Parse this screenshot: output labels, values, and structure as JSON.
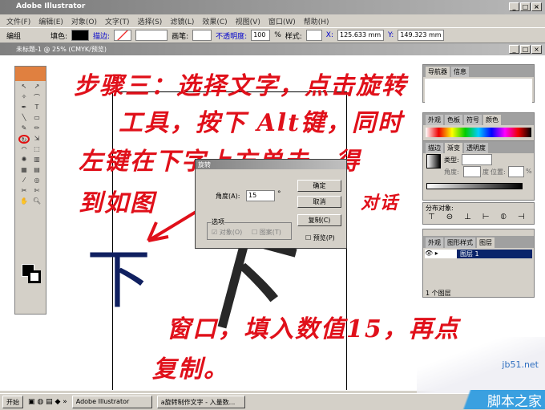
{
  "app": {
    "title": "Adobe Illustrator",
    "doc_title": "未标题-1 @ 25% (CMYK/预览)"
  },
  "menu": [
    "文件(F)",
    "编辑(E)",
    "对象(O)",
    "文字(T)",
    "选择(S)",
    "滤镜(L)",
    "效果(C)",
    "视图(V)",
    "窗口(W)",
    "帮助(H)"
  ],
  "toolbar": {
    "group": "编组",
    "fill": "填色:",
    "stroke": "描边:",
    "brush": "画笔:",
    "opacity": "不透明度:",
    "opacity_value": "100",
    "pct": "%",
    "style": "样式:",
    "x_label": "X:",
    "x_value": "125.633 mm",
    "y_label": "Y:",
    "y_value": "149.323 mm"
  },
  "dialog": {
    "title": "旋转",
    "angle_label": "角度(A):",
    "angle_value": "15",
    "deg": "°",
    "ok": "确定",
    "cancel": "取消",
    "copy": "复制(C)",
    "options": "选项",
    "objects": "对象(O)",
    "patterns": "图案(T)",
    "preview": "预览(P)"
  },
  "panels": {
    "nav_tabs": [
      "导航器",
      "信息"
    ],
    "color_tabs": [
      "外观",
      "色板",
      "符号",
      "颜色"
    ],
    "gradient_tabs": [
      "描边",
      "渐变",
      "透明度"
    ],
    "type_label": "类型:",
    "angle_label": "角度:",
    "deg": "度",
    "location_label": "位置:",
    "pct": "%",
    "distribute": "分布对象:",
    "layer_tabs": [
      "外观",
      "图形样式",
      "图层"
    ],
    "layer_name": "图层 1",
    "layer_count": "1 个图层"
  },
  "canvas": {
    "glyph": "下"
  },
  "annotation": {
    "lines": [
      "步骤三：选择文字，点击旋转",
      "工具，按下 Alt键，同时",
      "左键在下字上方单击，得",
      "到如图"
    ],
    "side": "对话",
    "bottom": [
      "窗口，填入数值15，再点",
      "复制。"
    ]
  },
  "taskbar": {
    "start": "开始",
    "items": [
      "Adobe Illustrator",
      "a旋转制作文字 - 入量数..."
    ]
  },
  "watermark": {
    "site": "jb51.net",
    "name": "脚本之家"
  }
}
